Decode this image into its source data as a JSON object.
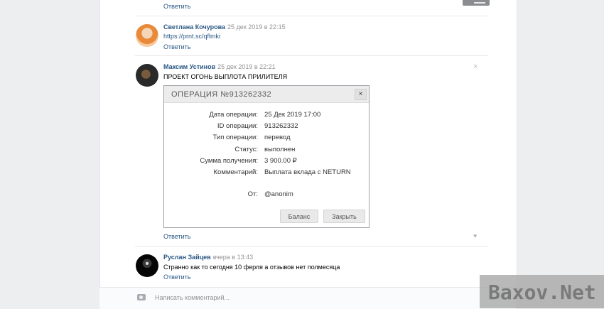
{
  "reply_label": "Ответить",
  "comments": [
    {
      "author": "Светлана Кочурова",
      "date": "25 дек 2019 в 22:15",
      "text": "https://prnt.sc/qflmki"
    },
    {
      "author": "Максим Устинов",
      "date": "25 дек 2019 в 22:21",
      "text": "ПРОЕКТ ОГОНЬ ВЫПЛОТА ПРИЛИТЕЛЯ"
    },
    {
      "author": "Руслан Зайцев",
      "date": "вчера в 13:43",
      "text": "Странно как то сегодня 10 ферля а отзывов нет полмесяца"
    }
  ],
  "operation": {
    "title": "ОПЕРАЦИЯ №913262332",
    "close_glyph": "×",
    "rows": [
      {
        "label": "Дата операции:",
        "value": "25 Дек 2019 17:00"
      },
      {
        "label": "ID операции:",
        "value": "913262332"
      },
      {
        "label": "Тип операции:",
        "value": "перевод"
      },
      {
        "label": "Статус:",
        "value": "выполнен"
      },
      {
        "label": "Сумма получения:",
        "value": "3 900.00 ₽"
      },
      {
        "label": "Комментарий:",
        "value": "Выплата вклада с NETURN"
      },
      {
        "label": "От:",
        "value": "@anonim"
      }
    ],
    "balance_button": "Баланс",
    "close_button": "Закрыть"
  },
  "comment_input_placeholder": "Написать комментарий...",
  "watermark": "Baxov.Net",
  "icons": {
    "close": "close-icon",
    "like": "heart-icon",
    "attach": "camera-icon"
  }
}
